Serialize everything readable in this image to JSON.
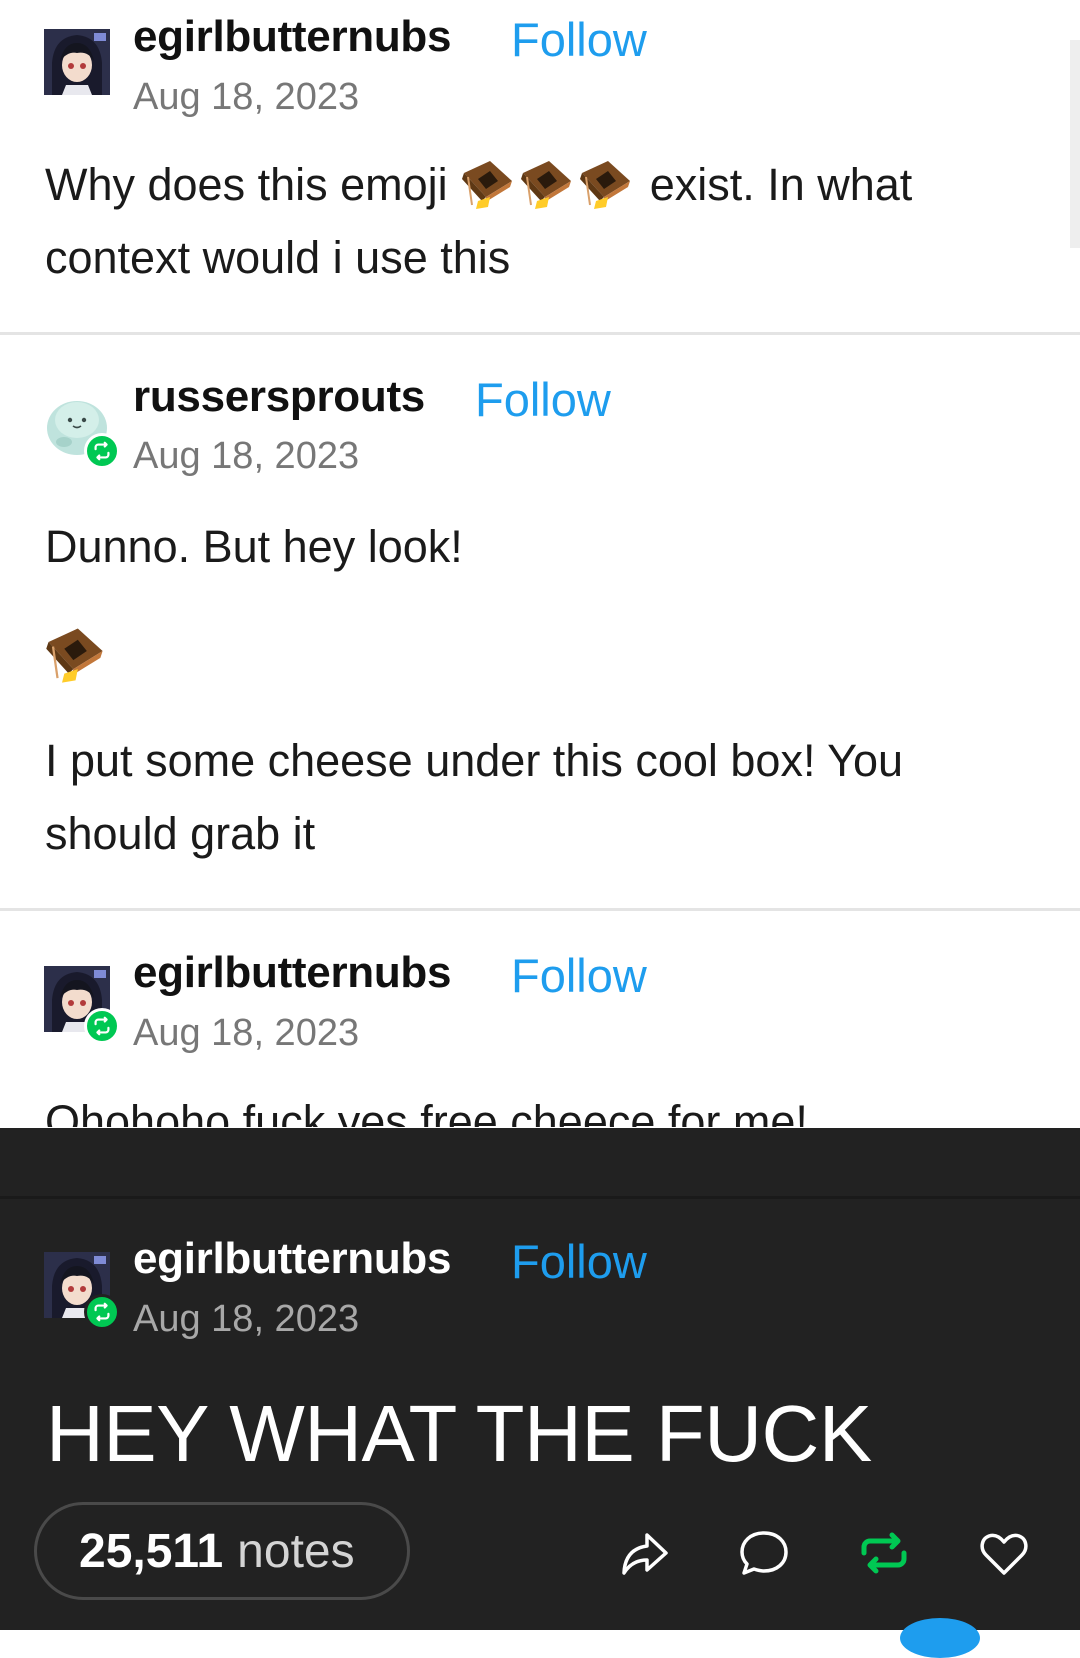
{
  "posts": [
    {
      "username": "egirlbutternubs",
      "follow_label": "Follow",
      "date": "Aug 18, 2023",
      "lines": [
        "Why does this emoji",
        "exist. In what context would i use this"
      ],
      "avatar_icon": "anime-avatar-icon",
      "inline_emoji": "box-trap-emoji-icon",
      "inline_emoji_count": 3
    },
    {
      "username": "russersprouts",
      "follow_label": "Follow",
      "date": "Aug 18, 2023",
      "lines": [
        "Dunno. But hey look!",
        "I put some cheese under this cool box! You should grab it"
      ],
      "avatar_icon": "mint-creature-avatar-icon",
      "reblog_icon": "reblog-badge-icon",
      "inline_emoji": "box-trap-emoji-icon"
    },
    {
      "username": "egirlbutternubs",
      "follow_label": "Follow",
      "date": "Aug 18, 2023",
      "lines": [
        "Ohohoho fuck yes free cheece for me!"
      ],
      "avatar_icon": "anime-avatar-icon",
      "reblog_icon": "reblog-badge-icon"
    },
    {
      "username": "egirlbutternubs",
      "follow_label": "Follow",
      "date": "Aug 18, 2023",
      "lines": [
        "HEY WHAT THE FUCK"
      ],
      "avatar_icon": "anime-avatar-icon",
      "reblog_icon": "reblog-badge-icon"
    }
  ],
  "footer": {
    "notes_count": "25,511",
    "notes_label": "notes",
    "actions": [
      "share-icon",
      "reply-icon",
      "reblog-icon",
      "like-icon"
    ]
  },
  "colors": {
    "follow": "#1e9dee",
    "reblog_green": "#00c853",
    "dark_bg": "#222222"
  }
}
